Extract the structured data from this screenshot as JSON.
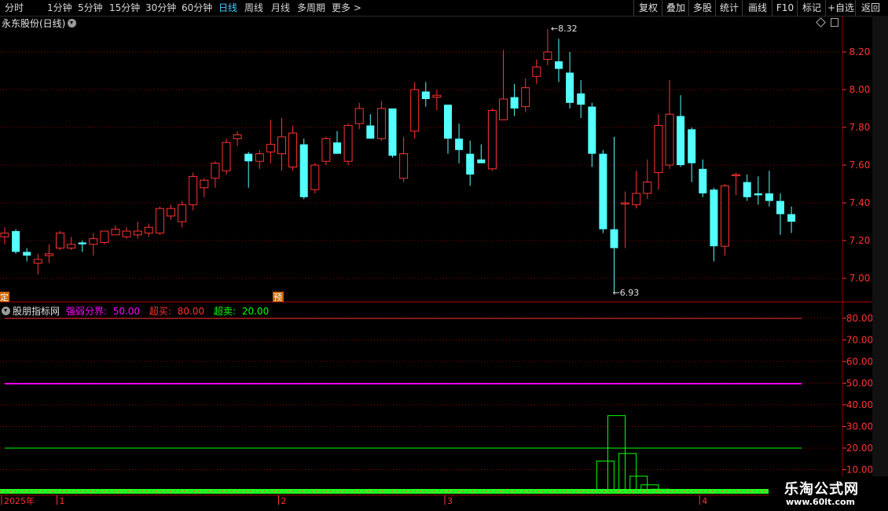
{
  "toolbar": {
    "periods": [
      "分时",
      "1分钟",
      "5分钟",
      "15分钟",
      "30分钟",
      "60分钟",
      "日线",
      "周线",
      "月线",
      "多周期",
      "更多 >"
    ],
    "active_period": "日线",
    "actions": [
      "复权",
      "叠加",
      "多股",
      "统计",
      "画线",
      "F10",
      "标记",
      "+自选",
      "返回"
    ]
  },
  "stock": {
    "title": "永东股份(日线)",
    "high_label": "8.32",
    "low_label": "6.93",
    "left_marker": "定",
    "mid_marker": "预",
    "price_axis": [
      "8.20",
      "8.00",
      "7.80",
      "7.60",
      "7.40",
      "7.20",
      "7.00"
    ]
  },
  "indicator": {
    "name": "股朋指标网",
    "line1_label": "强弱分界:",
    "line1_value": "50.00",
    "line2_label": "超买:",
    "line2_value": "80.00",
    "line3_label": "超卖:",
    "line3_value": "20.00",
    "axis": [
      "80.00",
      "70.00",
      "60.00",
      "50.00",
      "40.00",
      "30.00",
      "20.00",
      "10.00"
    ],
    "bars": [
      {
        "index": 54,
        "value": 14
      },
      {
        "index": 55,
        "value": 35
      },
      {
        "index": 56,
        "value": 17.5
      },
      {
        "index": 57,
        "value": 7
      },
      {
        "index": 58,
        "value": 3
      },
      {
        "index": 59,
        "value": 1
      }
    ]
  },
  "time_axis": {
    "labels": [
      "2025年",
      "1",
      "2",
      "3",
      "4"
    ],
    "label_index": [
      0,
      5,
      25,
      40,
      63
    ]
  },
  "watermark": {
    "title": "乐淘公式网",
    "url": "www.60lt.com"
  },
  "colors": {
    "up": "#ff3232",
    "down": "#54ffff",
    "grid": "#8b0000",
    "strong_weak": "#ff00ff",
    "overbought": "#ff3232",
    "oversold": "#00ff00",
    "axis_text": "#ff3232"
  },
  "chart_data": {
    "type": "candlestick",
    "candles": [
      [
        7.22,
        7.24,
        7.27,
        7.18
      ],
      [
        7.25,
        7.14,
        7.26,
        7.13
      ],
      [
        7.14,
        7.12,
        7.16,
        7.09
      ],
      [
        7.08,
        7.1,
        7.13,
        7.02
      ],
      [
        7.12,
        7.13,
        7.18,
        7.08
      ],
      [
        7.16,
        7.24,
        7.25,
        7.15
      ],
      [
        7.16,
        7.18,
        7.22,
        7.15
      ],
      [
        7.19,
        7.18,
        7.2,
        7.14
      ],
      [
        7.18,
        7.21,
        7.24,
        7.12
      ],
      [
        7.19,
        7.25,
        7.25,
        7.18
      ],
      [
        7.23,
        7.26,
        7.28,
        7.23
      ],
      [
        7.22,
        7.25,
        7.27,
        7.21
      ],
      [
        7.23,
        7.25,
        7.3,
        7.21
      ],
      [
        7.24,
        7.27,
        7.29,
        7.22
      ],
      [
        7.24,
        7.37,
        7.38,
        7.23
      ],
      [
        7.33,
        7.37,
        7.39,
        7.31
      ],
      [
        7.3,
        7.39,
        7.41,
        7.27
      ],
      [
        7.39,
        7.54,
        7.56,
        7.36
      ],
      [
        7.48,
        7.52,
        7.53,
        7.43
      ],
      [
        7.53,
        7.61,
        7.62,
        7.48
      ],
      [
        7.57,
        7.72,
        7.74,
        7.55
      ],
      [
        7.74,
        7.76,
        7.78,
        7.7
      ],
      [
        7.66,
        7.62,
        7.67,
        7.48
      ],
      [
        7.62,
        7.66,
        7.68,
        7.58
      ],
      [
        7.67,
        7.71,
        7.84,
        7.61
      ],
      [
        7.66,
        7.75,
        7.85,
        7.57
      ],
      [
        7.59,
        7.77,
        7.81,
        7.57
      ],
      [
        7.71,
        7.43,
        7.74,
        7.42
      ],
      [
        7.47,
        7.6,
        7.61,
        7.45
      ],
      [
        7.62,
        7.74,
        7.75,
        7.6
      ],
      [
        7.72,
        7.66,
        7.78,
        7.66
      ],
      [
        7.62,
        7.81,
        7.82,
        7.6
      ],
      [
        7.82,
        7.9,
        7.93,
        7.79
      ],
      [
        7.81,
        7.74,
        7.87,
        7.74
      ],
      [
        7.74,
        7.9,
        7.94,
        7.73
      ],
      [
        7.9,
        7.65,
        7.9,
        7.64
      ],
      [
        7.53,
        7.66,
        7.75,
        7.51
      ],
      [
        7.78,
        8.0,
        8.04,
        7.74
      ],
      [
        7.99,
        7.95,
        8.04,
        7.91
      ],
      [
        7.96,
        7.97,
        8.0,
        7.89
      ],
      [
        7.92,
        7.74,
        7.92,
        7.66
      ],
      [
        7.74,
        7.68,
        7.82,
        7.61
      ],
      [
        7.66,
        7.55,
        7.73,
        7.49
      ],
      [
        7.63,
        7.61,
        7.71,
        7.61
      ],
      [
        7.58,
        7.89,
        7.9,
        7.57
      ],
      [
        7.84,
        7.95,
        8.21,
        7.84
      ],
      [
        7.96,
        7.9,
        8.03,
        7.86
      ],
      [
        7.91,
        8.01,
        8.06,
        7.88
      ],
      [
        8.07,
        8.12,
        8.16,
        8.03
      ],
      [
        8.16,
        8.2,
        8.32,
        8.13
      ],
      [
        8.15,
        8.11,
        8.27,
        8.04
      ],
      [
        8.09,
        7.93,
        8.2,
        7.9
      ],
      [
        7.98,
        7.92,
        8.05,
        7.85
      ],
      [
        7.91,
        7.66,
        7.93,
        7.59
      ],
      [
        7.66,
        7.26,
        7.68,
        7.24
      ],
      [
        7.26,
        7.16,
        7.75,
        6.93
      ],
      [
        7.4,
        7.4,
        7.46,
        7.16
      ],
      [
        7.39,
        7.45,
        7.57,
        7.37
      ],
      [
        7.45,
        7.51,
        7.63,
        7.42
      ],
      [
        7.56,
        7.81,
        7.87,
        7.47
      ],
      [
        7.6,
        7.87,
        8.05,
        7.58
      ],
      [
        7.86,
        7.6,
        7.97,
        7.59
      ],
      [
        7.79,
        7.61,
        7.8,
        7.51
      ],
      [
        7.58,
        7.45,
        7.63,
        7.43
      ],
      [
        7.47,
        7.17,
        7.48,
        7.09
      ],
      [
        7.17,
        7.49,
        7.5,
        7.12
      ],
      [
        7.55,
        7.55,
        7.56,
        7.44
      ],
      [
        7.51,
        7.43,
        7.55,
        7.41
      ],
      [
        7.45,
        7.44,
        7.54,
        7.39
      ],
      [
        7.45,
        7.41,
        7.57,
        7.38
      ],
      [
        7.41,
        7.34,
        7.45,
        7.23
      ],
      [
        7.34,
        7.3,
        7.38,
        7.24
      ]
    ],
    "price_range": [
      6.9,
      8.35
    ],
    "indicator_range": [
      0,
      85
    ]
  }
}
